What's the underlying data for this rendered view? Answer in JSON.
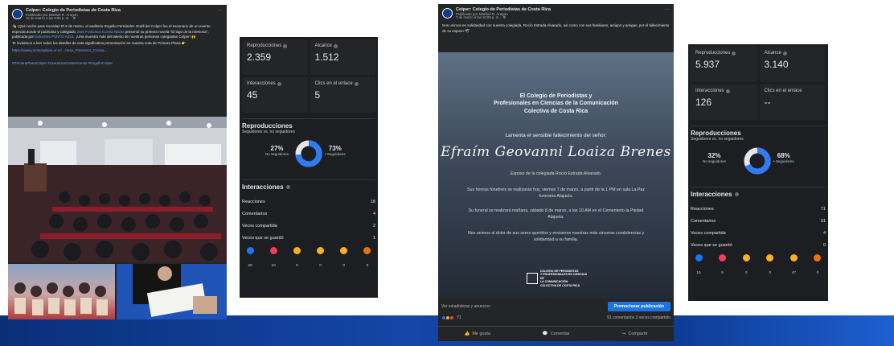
{
  "post1": {
    "page_name": "Colper: Colegio de Periodistas de Costa Rica",
    "published_by": "Publicado por Maribel R. Aragón",
    "time": "16 de marzo a las 8:05 p. m. · ⚙",
    "paragraph1_a": "🎭 ¡Qué noche para recordar! El 5 de marzo, el auditorio Rogelio Fernández Güell del Colper fue el escenario de un evento especial donde el publicista y colegiado",
    "author_link": "José Francisco Correa Navas",
    "paragraph1_b": "presentó su primera novela \"El lago de la memoria\", publicada por",
    "publisher_link": "Ediciones PUNTO AZUL.",
    "paragraph1_c": "¡Una muestra más del talento de nuestras personas colegiadas Colper! 🙌",
    "paragraph2": "Te invitamos a leer todos los detalles de esta significativa presentación en nuestra nota de Primera Plana 👉",
    "url": "https://www.primeraplana.or.cr/.../Jose_Francisco_Correa...",
    "hashtags": "#PrimeraPlanaColper #LiteraturaCostarricense #OrgulloColper"
  },
  "insights1": {
    "metrics": [
      {
        "label": "Reproducciones",
        "value": "2.359"
      },
      {
        "label": "Alcance",
        "value": "1.512"
      },
      {
        "label": "Interacciones",
        "value": "45"
      },
      {
        "label": "Clics en el enlace",
        "value": "5"
      }
    ],
    "repro_title": "Reproducciones",
    "repro_sub": "Seguidores vs. no seguidores",
    "non_followers_pct": "27%",
    "non_followers_label": "No seguidores",
    "followers_pct": "73%",
    "followers_label": "• Seguidores",
    "followers_fraction": 0.73,
    "interactions_title": "Interacciones",
    "rows": [
      {
        "label": "Reacciones",
        "value": "18"
      },
      {
        "label": "Comentarios",
        "value": "4"
      },
      {
        "label": "Veces compartida",
        "value": "2"
      },
      {
        "label": "Veces que se guardó",
        "value": "1"
      }
    ],
    "emojis": [
      {
        "icon": "like-icon",
        "color": "#1877f2",
        "count": "29"
      },
      {
        "icon": "love-icon",
        "color": "#f33e58",
        "count": "10"
      },
      {
        "icon": "haha-icon",
        "color": "#f7b125",
        "count": "0"
      },
      {
        "icon": "wow-icon",
        "color": "#f7b125",
        "count": "0"
      },
      {
        "icon": "sad-icon",
        "color": "#f7b125",
        "count": "0"
      },
      {
        "icon": "angry-icon",
        "color": "#e9710f",
        "count": "0"
      }
    ]
  },
  "post2": {
    "page_name": "Colper: Colegio de Periodistas de Costa Rica",
    "published_by": "Publicado por Maribel R. Aragón",
    "time": "7 de marzo a las 10:08 p. m. · ⚙",
    "body": "Nos unimos en solidaridad con nuestra colegiada, Rocío Estrada Alvarado, así como con sus familiares, amigos y amigas, por el fallecimiento de su esposo 🕊",
    "flyer_org": "El Colegio de Periodistas y\nProfesionales en Ciencias de la Comunicación\nColectiva de Costa Rica",
    "flyer_lament": "Lamenta el sensible fallecimiento del señor:",
    "flyer_name": "Efraím Geovanni Loaiza Brenes",
    "flyer_p1": "Esposo de la colegiada Rocío Estrada Alvarado.",
    "flyer_p2": "Sus honras fúnebres se realizarán hoy, viernes 7 de marzo, a partir de la 1 PM en sala La Paz funeraria Alajuela.",
    "flyer_p3": "Su funeral se realizará mañana, sábado 8 de marzo, a las 10 AM en el Cementerio la Piedad Alajuela.",
    "flyer_p4": "Nos unimos al dolor de sus seres queridos y enviamos nuestras más sinceras condolencias y solidaridad a su familia.",
    "flyer_logo": "COLEGIO DE PERIODISTAS\nY PROFESIONALES EN CIENCIAS DE\nLA COMUNICACIÓN\nCOLECTIVA DE COSTA RICA",
    "stats_link": "Ver estadísticas y anuncios",
    "promote": "Promocionar publicación",
    "reaction_count": "71",
    "comments_shares": "91 comentarios   3 veces compartido",
    "like": "Me gusta",
    "comment": "Comentar",
    "share": "Compartir"
  },
  "insights2": {
    "metrics": [
      {
        "label": "Reproducciones",
        "value": "5.937"
      },
      {
        "label": "Alcance",
        "value": "3.140"
      },
      {
        "label": "Interacciones",
        "value": "126"
      },
      {
        "label": "Clics en el enlace",
        "value": "--"
      }
    ],
    "repro_title": "Reproducciones",
    "repro_sub": "Seguidores vs. no seguidores",
    "non_followers_pct": "32%",
    "non_followers_label": "No seguidores",
    "followers_pct": "68%",
    "followers_label": "• Seguidores",
    "followers_fraction": 0.68,
    "interactions_title": "Interacciones",
    "rows": [
      {
        "label": "Reacciones",
        "value": "71"
      },
      {
        "label": "Comentarios",
        "value": "91"
      },
      {
        "label": "Veces compartida",
        "value": "4"
      },
      {
        "label": "Veces que se guardó",
        "value": "0"
      }
    ],
    "emojis": [
      {
        "icon": "like-icon",
        "color": "#1877f2",
        "count": "15"
      },
      {
        "icon": "love-icon",
        "color": "#f33e58",
        "count": "5"
      },
      {
        "icon": "haha-icon",
        "color": "#f7b125",
        "count": "0"
      },
      {
        "icon": "wow-icon",
        "color": "#f7b125",
        "count": "0"
      },
      {
        "icon": "sad-icon",
        "color": "#f7b125",
        "count": "47"
      },
      {
        "icon": "angry-icon",
        "color": "#e9710f",
        "count": "0"
      }
    ]
  }
}
